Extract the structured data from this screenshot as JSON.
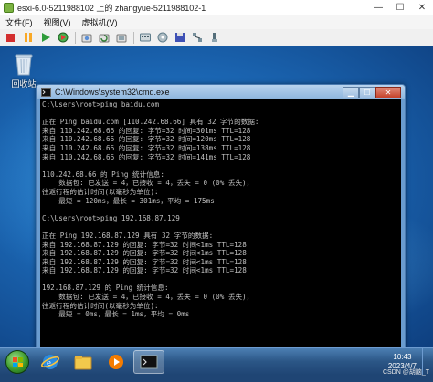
{
  "vm": {
    "title": "esxi-6.0-5211988102 上的 zhangyue-5211988102-1",
    "menus": [
      "文件(F)",
      "视图(V)",
      "虚拟机(V)"
    ],
    "toolbar_icons": [
      "stop-icon",
      "pause-icon",
      "play-icon",
      "restart-icon",
      "snapshot-icon",
      "snapshot-revert-icon",
      "snapshot-manager-icon",
      "ctrl-alt-del-icon",
      "cd-icon",
      "floppy-icon",
      "network-icon",
      "usb-icon"
    ]
  },
  "desktop": {
    "recycle_bin_label": "回收站"
  },
  "cmd": {
    "title": "C:\\Windows\\system32\\cmd.exe",
    "lines": [
      "C:\\Users\\root>ping baidu.com",
      "",
      "正在 Ping baidu.com [110.242.68.66] 具有 32 字节的数据:",
      "来自 110.242.68.66 的回复: 字节=32 时间=301ms TTL=128",
      "来自 110.242.68.66 的回复: 字节=32 时间=120ms TTL=128",
      "来自 110.242.68.66 的回复: 字节=32 时间=138ms TTL=128",
      "来自 110.242.68.66 的回复: 字节=32 时间=141ms TTL=128",
      "",
      "110.242.68.66 的 Ping 统计信息:",
      "    数据包: 已发送 = 4，已接收 = 4，丢失 = 0 (0% 丢失)，",
      "往返行程的估计时间(以毫秒为单位):",
      "    最短 = 120ms，最长 = 301ms，平均 = 175ms",
      "",
      "C:\\Users\\root>ping 192.168.87.129",
      "",
      "正在 Ping 192.168.87.129 具有 32 字节的数据:",
      "来自 192.168.87.129 的回复: 字节=32 时间<1ms TTL=128",
      "来自 192.168.87.129 的回复: 字节=32 时间<1ms TTL=128",
      "来自 192.168.87.129 的回复: 字节=32 时间<1ms TTL=128",
      "来自 192.168.87.129 的回复: 字节=32 时间<1ms TTL=128",
      "",
      "192.168.87.129 的 Ping 统计信息:",
      "    数据包: 已发送 = 4，已接收 = 4，丢失 = 0 (0% 丢失)，",
      "往返行程的估计时间(以毫秒为单位):",
      "    最短 = 0ms，最长 = 1ms，平均 = 0ms",
      ""
    ]
  },
  "taskbar": {
    "time": "10:43",
    "date": "2023/4/7"
  },
  "watermark": "CSDN @胡脑_T"
}
